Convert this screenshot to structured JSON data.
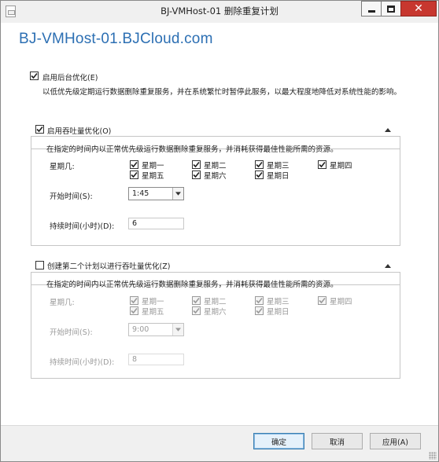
{
  "window": {
    "title": "BJ-VMHost-01 删除重复计划",
    "close_glyph": "✕"
  },
  "host_name": "BJ-VMHost-01.BJCloud.com",
  "background_optimization": {
    "label": "启用后台优化(E)",
    "checked": true,
    "description": "以低优先级定期运行数据删除重复服务，并在系统繁忙时暂停此服务，以最大程度地降低对系统性能的影响。"
  },
  "throughput_schedule": {
    "label": "启用吞吐量优化(O)",
    "checked": true,
    "description": "在指定的时间内以正常优先级运行数据删除重复服务，并消耗获得最佳性能所需的资源。",
    "weekday_label": "星期几:",
    "days": [
      "星期一",
      "星期二",
      "星期三",
      "星期四",
      "星期五",
      "星期六",
      "星期日"
    ],
    "start_label": "开始时间(S):",
    "start_value": "1:45",
    "duration_label": "持续时间(小时)(D):",
    "duration_value": "6"
  },
  "second_schedule": {
    "label": "创建第二个计划以进行吞吐量优化(Z)",
    "checked": false,
    "description": "在指定的时间内以正常优先级运行数据删除重复服务，并消耗获得最佳性能所需的资源。",
    "weekday_label": "星期几:",
    "days": [
      "星期一",
      "星期二",
      "星期三",
      "星期四",
      "星期五",
      "星期六",
      "星期日"
    ],
    "start_label": "开始时间(S):",
    "start_value": "9:00",
    "duration_label": "持续时间(小时)(D):",
    "duration_value": "8"
  },
  "buttons": {
    "ok": "确定",
    "cancel": "取消",
    "apply": "应用(A)"
  },
  "colors": {
    "accent": "#2c6fb3",
    "close_button": "#c7372f"
  },
  "icons": {
    "check": "check-icon",
    "collapse": "chevron-up-icon",
    "dropdown": "chevron-down-icon"
  }
}
